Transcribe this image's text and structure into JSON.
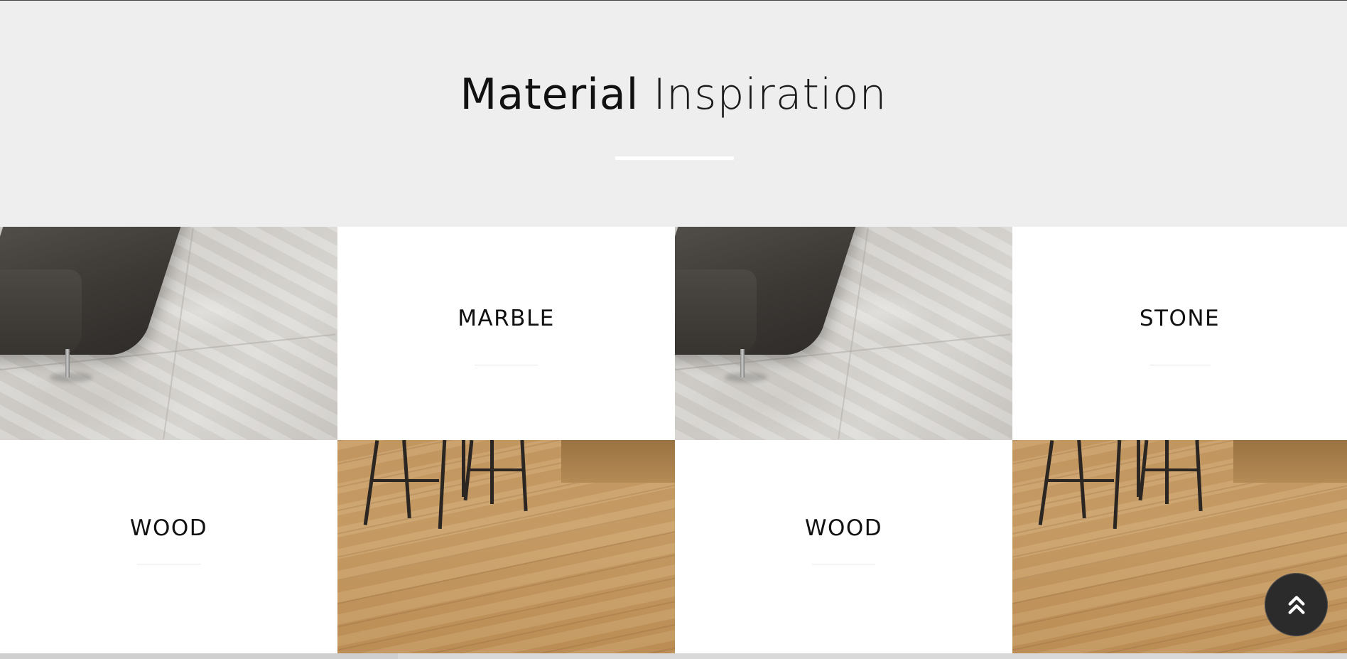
{
  "hero": {
    "title_bold": "Material",
    "title_light": "Inspiration",
    "background_color": "#eeeeee"
  },
  "tiles": {
    "marble_label": "MARBLE",
    "stone_label": "STONE",
    "wood_label_1": "WOOD",
    "wood_label_2": "WOOD"
  },
  "images": {
    "marble_image": "marble-floor-with-armchair-image",
    "wood_image": "wood-floor-with-bar-stools-image"
  },
  "scroll_top": {
    "icon": "double-chevron-up-icon",
    "color": "#2b2b2b"
  }
}
